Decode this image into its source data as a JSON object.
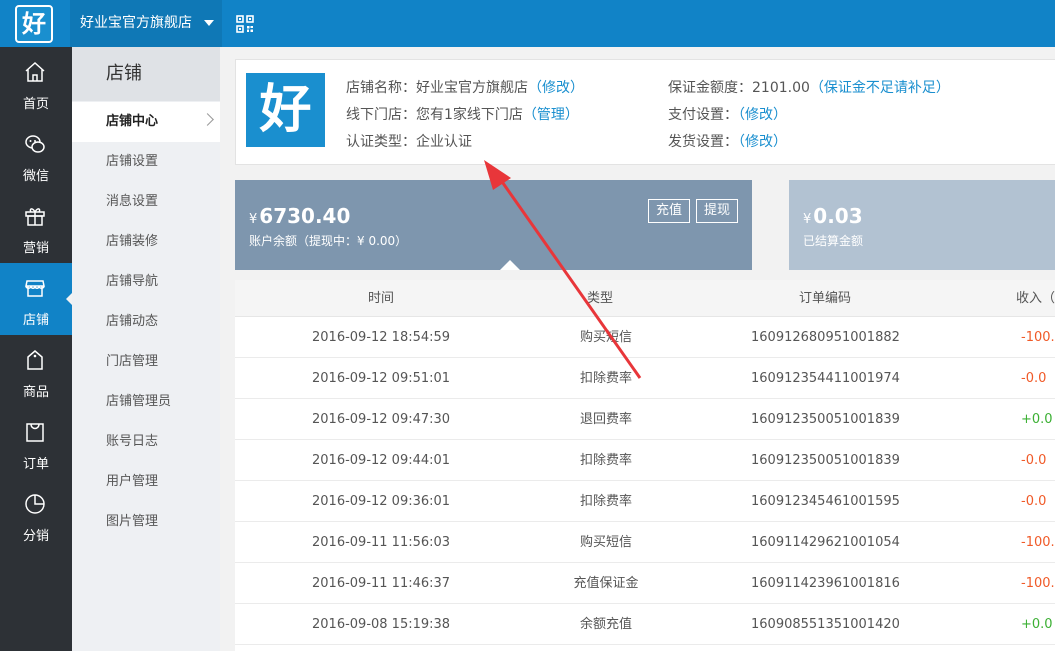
{
  "topbar": {
    "logo_text": "好",
    "store_name": "好业宝官方旗舰店",
    "qr_icon": "qr-code-icon"
  },
  "nav": {
    "items": [
      {
        "label": "首页",
        "icon": "home-icon"
      },
      {
        "label": "微信",
        "icon": "wechat-icon"
      },
      {
        "label": "营销",
        "icon": "gift-icon"
      },
      {
        "label": "店铺",
        "icon": "store-icon"
      },
      {
        "label": "商品",
        "icon": "product-icon"
      },
      {
        "label": "订单",
        "icon": "order-icon"
      },
      {
        "label": "分销",
        "icon": "pie-chart-icon"
      }
    ]
  },
  "subnav": {
    "title": "店铺",
    "items": [
      {
        "label": "店铺中心"
      },
      {
        "label": "店铺设置"
      },
      {
        "label": "消息设置"
      },
      {
        "label": "店铺装修"
      },
      {
        "label": "店铺导航"
      },
      {
        "label": "店铺动态"
      },
      {
        "label": "门店管理"
      },
      {
        "label": "店铺管理员"
      },
      {
        "label": "账号日志"
      },
      {
        "label": "用户管理"
      },
      {
        "label": "图片管理"
      }
    ]
  },
  "info": {
    "logo_text": "好",
    "store_name_label": "店铺名称：",
    "store_name": "好业宝官方旗舰店",
    "store_name_link": "（修改）",
    "offline_label": "线下门店：",
    "offline_value": "您有1家线下门店",
    "offline_link": "（管理）",
    "cert_label": "认证类型：",
    "cert_value": "企业认证",
    "deposit_label": "保证金额度：",
    "deposit_value": "2101.00",
    "deposit_link": "（保证金不足请补足）",
    "payment_label": "支付设置：",
    "payment_link": "（修改）",
    "shipping_label": "发货设置：",
    "shipping_link": "（修改）"
  },
  "balance": {
    "currency": "¥",
    "amount": "6730.40",
    "sub": "账户余额（提现中：¥ 0.00）",
    "recharge_label": "充值",
    "withdraw_label": "提现"
  },
  "settled": {
    "currency": "¥",
    "amount": "0.03",
    "sub": "已结算金额"
  },
  "table": {
    "headers": {
      "time": "时间",
      "type": "类型",
      "order": "订单编码",
      "income": "收入（元"
    },
    "rows": [
      {
        "time": "2016-09-12 18:54:59",
        "type": "购买短信",
        "order": "160912680951001882",
        "income": "-100.",
        "sign": "neg"
      },
      {
        "time": "2016-09-12 09:51:01",
        "type": "扣除费率",
        "order": "160912354411001974",
        "income": "-0.0",
        "sign": "neg"
      },
      {
        "time": "2016-09-12 09:47:30",
        "type": "退回费率",
        "order": "160912350051001839",
        "income": "+0.0",
        "sign": "pos"
      },
      {
        "time": "2016-09-12 09:44:01",
        "type": "扣除费率",
        "order": "160912350051001839",
        "income": "-0.0",
        "sign": "neg"
      },
      {
        "time": "2016-09-12 09:36:01",
        "type": "扣除费率",
        "order": "160912345461001595",
        "income": "-0.0",
        "sign": "neg"
      },
      {
        "time": "2016-09-11 11:56:03",
        "type": "购买短信",
        "order": "160911429621001054",
        "income": "-100.",
        "sign": "neg"
      },
      {
        "time": "2016-09-11 11:46:37",
        "type": "充值保证金",
        "order": "160911423961001816",
        "income": "-100.",
        "sign": "neg"
      },
      {
        "time": "2016-09-08 15:19:38",
        "type": "余额充值",
        "order": "160908551351001420",
        "income": "+0.0",
        "sign": "pos"
      }
    ]
  },
  "colors": {
    "topbar": "#1183c7",
    "nav_bg": "#2d3136",
    "balance_card": "#7e96ae",
    "settled_card": "#b2c2d2",
    "link": "#1a8fcf",
    "negative": "#f05a28",
    "positive": "#3cb034",
    "annotation_arrow": "#e8363a"
  }
}
